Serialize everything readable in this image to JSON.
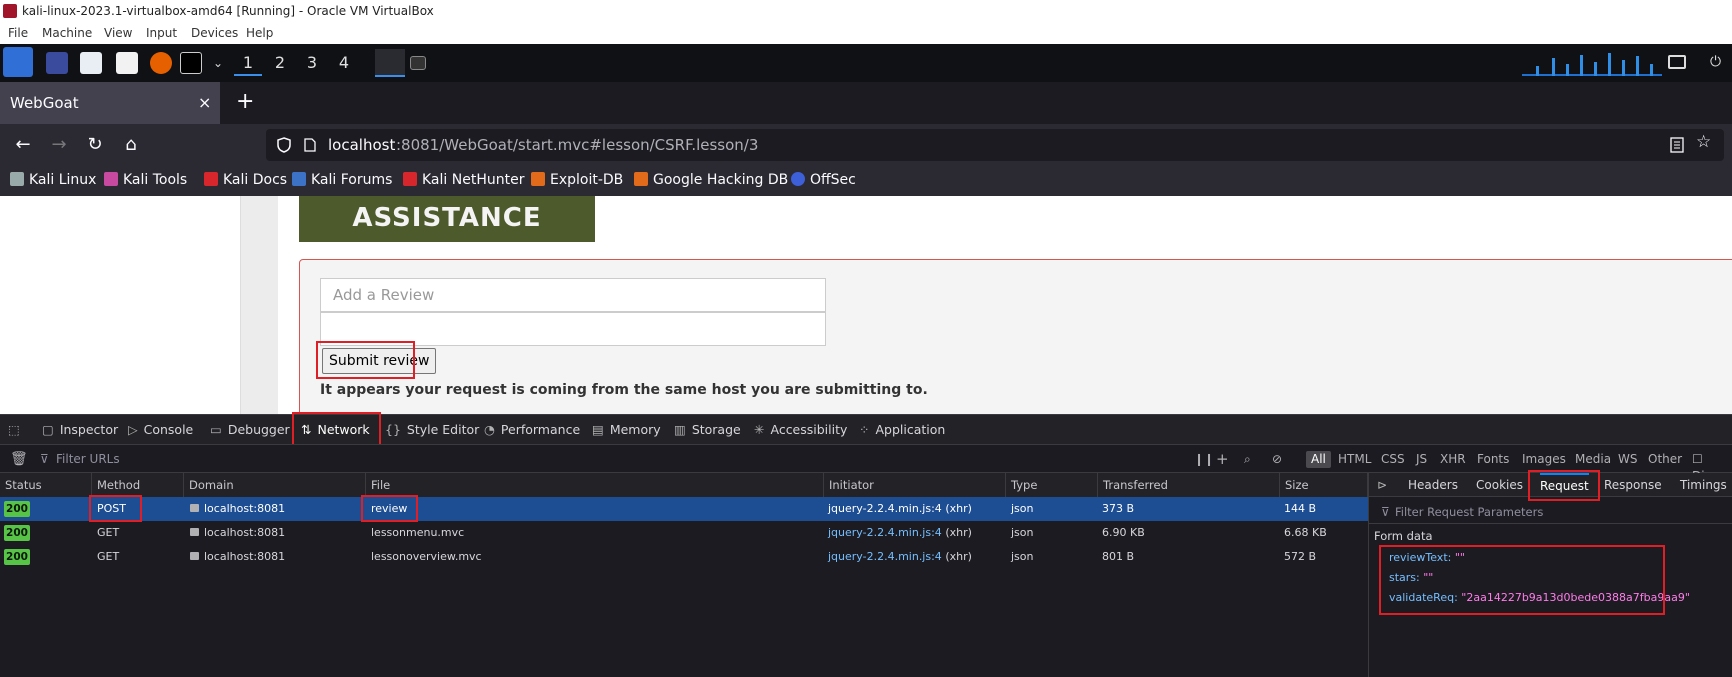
{
  "vbox": {
    "title": "kali-linux-2023.1-virtualbox-amd64 [Running] - Oracle VM VirtualBox",
    "menu": [
      "File",
      "Machine",
      "View",
      "Input",
      "Devices",
      "Help"
    ]
  },
  "panel": {
    "workspaces": [
      "1",
      "2",
      "3",
      "4"
    ]
  },
  "browser": {
    "tab_title": "WebGoat",
    "tab_close": "×",
    "new_tab": "+",
    "url_host": "localhost",
    "url_rest": ":8081/WebGoat/start.mvc#lesson/CSRF.lesson/3",
    "bookmarks": [
      "Kali Linux",
      "Kali Tools",
      "Kali Docs",
      "Kali Forums",
      "Kali NetHunter",
      "Exploit-DB",
      "Google Hacking DB",
      "OffSec"
    ]
  },
  "page": {
    "assist_text": "ASSISTANCE",
    "review_placeholder": "Add a Review",
    "submit_label": "Submit review",
    "message": "It appears your request is coming from the same host you are submitting to."
  },
  "devtools": {
    "tabs": [
      "Inspector",
      "Console",
      "Debugger",
      "Network",
      "Style Editor",
      "Performance",
      "Memory",
      "Storage",
      "Accessibility",
      "Application"
    ],
    "filter_placeholder": "Filter URLs",
    "type_filters": [
      "All",
      "HTML",
      "CSS",
      "JS",
      "XHR",
      "Fonts",
      "Images",
      "Media",
      "WS",
      "Other"
    ],
    "disable_label": "Disa",
    "columns": [
      "Status",
      "Method",
      "Domain",
      "File",
      "Initiator",
      "Type",
      "Transferred",
      "Size"
    ],
    "rows": [
      {
        "status": "200",
        "method": "POST",
        "domain": "localhost:8081",
        "file": "review",
        "initiator_link": "jquery-2.2.4.min.js:4",
        "initiator_suffix": "(xhr)",
        "type": "json",
        "transferred": "373 B",
        "size": "144 B"
      },
      {
        "status": "200",
        "method": "GET",
        "domain": "localhost:8081",
        "file": "lessonmenu.mvc",
        "initiator_link": "jquery-2.2.4.min.js:4",
        "initiator_suffix": "(xhr)",
        "type": "json",
        "transferred": "6.90 KB",
        "size": "6.68 KB"
      },
      {
        "status": "200",
        "method": "GET",
        "domain": "localhost:8081",
        "file": "lessonoverview.mvc",
        "initiator_link": "jquery-2.2.4.min.js:4",
        "initiator_suffix": "(xhr)",
        "type": "json",
        "transferred": "801 B",
        "size": "572 B"
      }
    ],
    "side_tabs": [
      "Headers",
      "Cookies",
      "Request",
      "Response",
      "Timings"
    ],
    "param_filter_placeholder": "Filter Request Parameters",
    "form_data_label": "Form data",
    "form_data": [
      {
        "key": "reviewText:",
        "value": "\"\""
      },
      {
        "key": "stars:",
        "value": "\"\""
      },
      {
        "key": "validateReq:",
        "value": "\"2aa14227b9a13d0bede0388a7fba9aa9\""
      }
    ]
  }
}
